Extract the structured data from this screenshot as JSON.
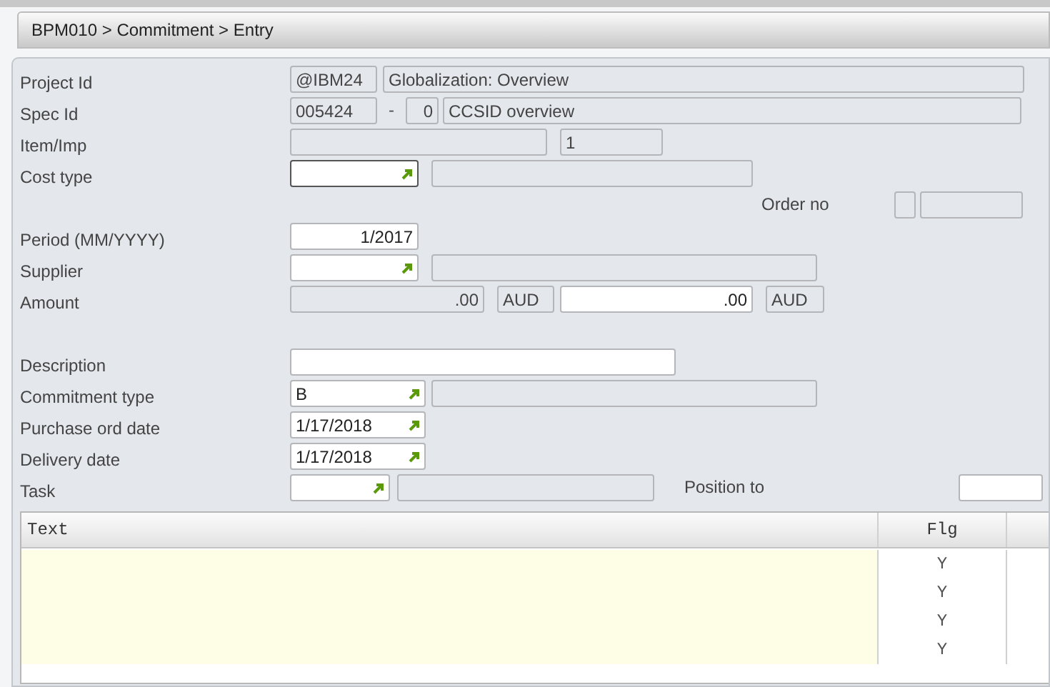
{
  "breadcrumb": "BPM010 > Commitment > Entry",
  "form": {
    "rows": [
      {
        "label": "Project Id",
        "fields": [
          {
            "kind": "readonly",
            "value": "@IBM24"
          },
          {
            "kind": "readonly",
            "value": "Globalization: Overview"
          }
        ]
      },
      {
        "label": "Spec Id",
        "fields": [
          {
            "kind": "readonly",
            "value": "005424"
          },
          {
            "kind": "text",
            "value": "-"
          },
          {
            "kind": "readonly",
            "value": "0"
          },
          {
            "kind": "readonly",
            "value": "CCSID overview"
          }
        ]
      },
      {
        "label": "Item/Imp",
        "fields": [
          {
            "kind": "readonly"
          },
          {
            "kind": "readonly",
            "value": "1"
          }
        ]
      },
      {
        "label": "Cost type",
        "fields": [
          {
            "kind": "lookup",
            "focused": true
          },
          {
            "kind": "readonly"
          }
        ]
      },
      {
        "fields": [
          {
            "kind": "label",
            "value": "Order no"
          },
          {
            "kind": "readonly"
          },
          {
            "kind": "readonly"
          }
        ]
      },
      {
        "label": "Period (MM/YYYY)",
        "fields": [
          {
            "kind": "input",
            "focused": false,
            "value": "1/2017"
          }
        ]
      },
      {
        "label": "Supplier",
        "fields": [
          {
            "kind": "lookup",
            "focused": false
          },
          {
            "kind": "readonly"
          }
        ]
      },
      {
        "label": "Amount",
        "fields": [
          {
            "kind": "readonly",
            "value": ".00"
          },
          {
            "kind": "readonly",
            "value": "AUD"
          },
          {
            "kind": "input",
            "focused": false,
            "value": ".00"
          },
          {
            "kind": "readonly",
            "value": "AUD"
          }
        ]
      },
      {
        "fields": []
      },
      {
        "label": "Description",
        "fields": [
          {
            "kind": "input",
            "focused": false
          }
        ]
      },
      {
        "label": "Commitment type",
        "fields": [
          {
            "kind": "lookup",
            "focused": false,
            "value": "B"
          },
          {
            "kind": "readonly"
          }
        ]
      },
      {
        "label": "Purchase ord date",
        "fields": [
          {
            "kind": "lookup",
            "focused": false,
            "value": "1/17/2018"
          }
        ]
      },
      {
        "label": "Delivery date",
        "fields": [
          {
            "kind": "lookup",
            "focused": false,
            "value": "1/17/2018"
          }
        ]
      },
      {
        "label": "Task",
        "fields": [
          {
            "kind": "lookup",
            "focused": false
          },
          {
            "kind": "readonly"
          },
          {
            "kind": "label",
            "value": "Position to"
          },
          {
            "kind": "input",
            "focused": false
          }
        ]
      }
    ]
  },
  "table": {
    "columns": [
      "Text",
      "Flg"
    ],
    "rows": [
      {
        "flag": "Y"
      },
      {
        "flag": "Y"
      },
      {
        "flag": "Y"
      },
      {
        "flag": "Y"
      }
    ]
  }
}
